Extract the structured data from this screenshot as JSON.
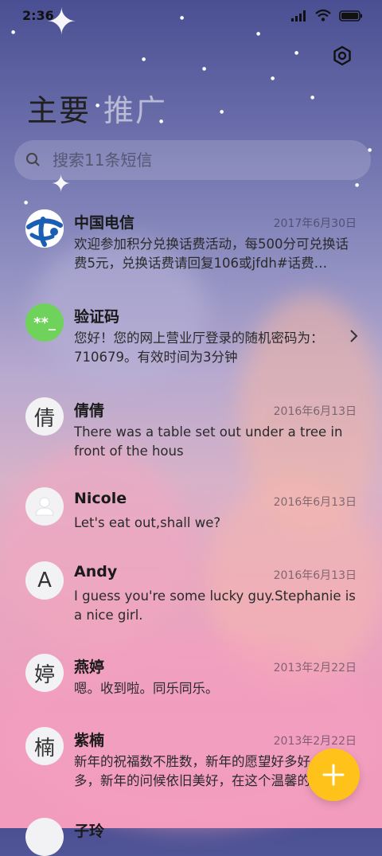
{
  "status_bar": {
    "time": "2:36"
  },
  "tabs": [
    {
      "label": "主要",
      "active": true
    },
    {
      "label": "推广",
      "active": false
    }
  ],
  "search": {
    "placeholder": "搜索11条短信"
  },
  "messages": [
    {
      "avatar_type": "logo",
      "avatar_icon": "china-telecom-logo-icon",
      "name": "中国电信",
      "date": "2017年6月30日",
      "preview": "欢迎参加积分兑换话费活动，每500分可兑换话费5元，兑换话费请回复106或jfdh#话费…"
    },
    {
      "avatar_type": "code",
      "avatar_icon": "verification-code-icon",
      "avatar_text": "**_",
      "name": "验证码",
      "date": "",
      "preview": "您好！您的网上营业厅登录的随机密码为：710679。有效时间为3分钟",
      "has_chevron": true
    },
    {
      "avatar_type": "letter",
      "avatar_text": "倩",
      "name": "倩倩",
      "date": "2016年6月13日",
      "preview": "There was a table set out under a tree in front of the hous"
    },
    {
      "avatar_type": "person",
      "avatar_icon": "person-icon",
      "name": "Nicole",
      "date": "2016年6月13日",
      "preview": "Let's eat out,shall we?"
    },
    {
      "avatar_type": "letter",
      "avatar_text": "A",
      "name": "Andy",
      "date": "2016年6月13日",
      "preview": "I guess you're some lucky guy.Stephanie is a nice girl."
    },
    {
      "avatar_type": "letter",
      "avatar_text": "婷",
      "name": "燕婷",
      "date": "2013年2月22日",
      "preview": "嗯。收到啦。同乐同乐。"
    },
    {
      "avatar_type": "letter",
      "avatar_text": "楠",
      "name": "紫楠",
      "date": "2013年2月22日",
      "preview": "新年的祝福数不胜数，新年的愿望好多好多，新年的问候依旧美好，在这个温馨的时刻…"
    },
    {
      "avatar_type": "letter",
      "avatar_text": "",
      "name": "子玲",
      "date": "",
      "preview": ""
    }
  ],
  "colors": {
    "fab": "#ffc21a",
    "code_avatar": "#6fd25a",
    "telecom_blue": "#1b5fb4"
  }
}
